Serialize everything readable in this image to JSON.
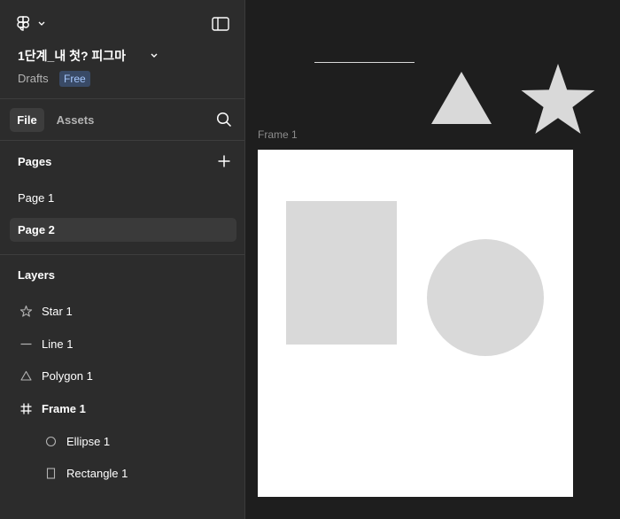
{
  "header": {
    "file_title": "1단계_내 첫? 피그마",
    "project": "Drafts",
    "plan_badge": "Free"
  },
  "tabs": [
    {
      "label": "File",
      "selected": true
    },
    {
      "label": "Assets",
      "selected": false
    }
  ],
  "pages": {
    "heading": "Pages",
    "items": [
      {
        "label": "Page 1",
        "selected": false
      },
      {
        "label": "Page 2",
        "selected": true
      }
    ]
  },
  "layers": {
    "heading": "Layers",
    "items": [
      {
        "label": "Star 1",
        "icon": "star-icon",
        "indent": 0
      },
      {
        "label": "Line 1",
        "icon": "line-icon",
        "indent": 0
      },
      {
        "label": "Polygon 1",
        "icon": "triangle-icon",
        "indent": 0
      },
      {
        "label": "Frame 1",
        "icon": "frame-hash-icon",
        "indent": 0
      },
      {
        "label": "Ellipse 1",
        "icon": "circle-icon",
        "indent": 1
      },
      {
        "label": "Rectangle 1",
        "icon": "rectangle-icon",
        "indent": 1
      }
    ]
  },
  "canvas": {
    "frame_label": "Frame 1",
    "shape_fill": "#d9d9d9",
    "frame_fill": "#ffffff"
  },
  "colors": {
    "sidebar_bg": "#2c2c2c",
    "canvas_bg": "#1e1e1e",
    "selected_row": "#3a3a3a",
    "badge_bg": "#394a66",
    "badge_text": "#a6c8ff"
  }
}
